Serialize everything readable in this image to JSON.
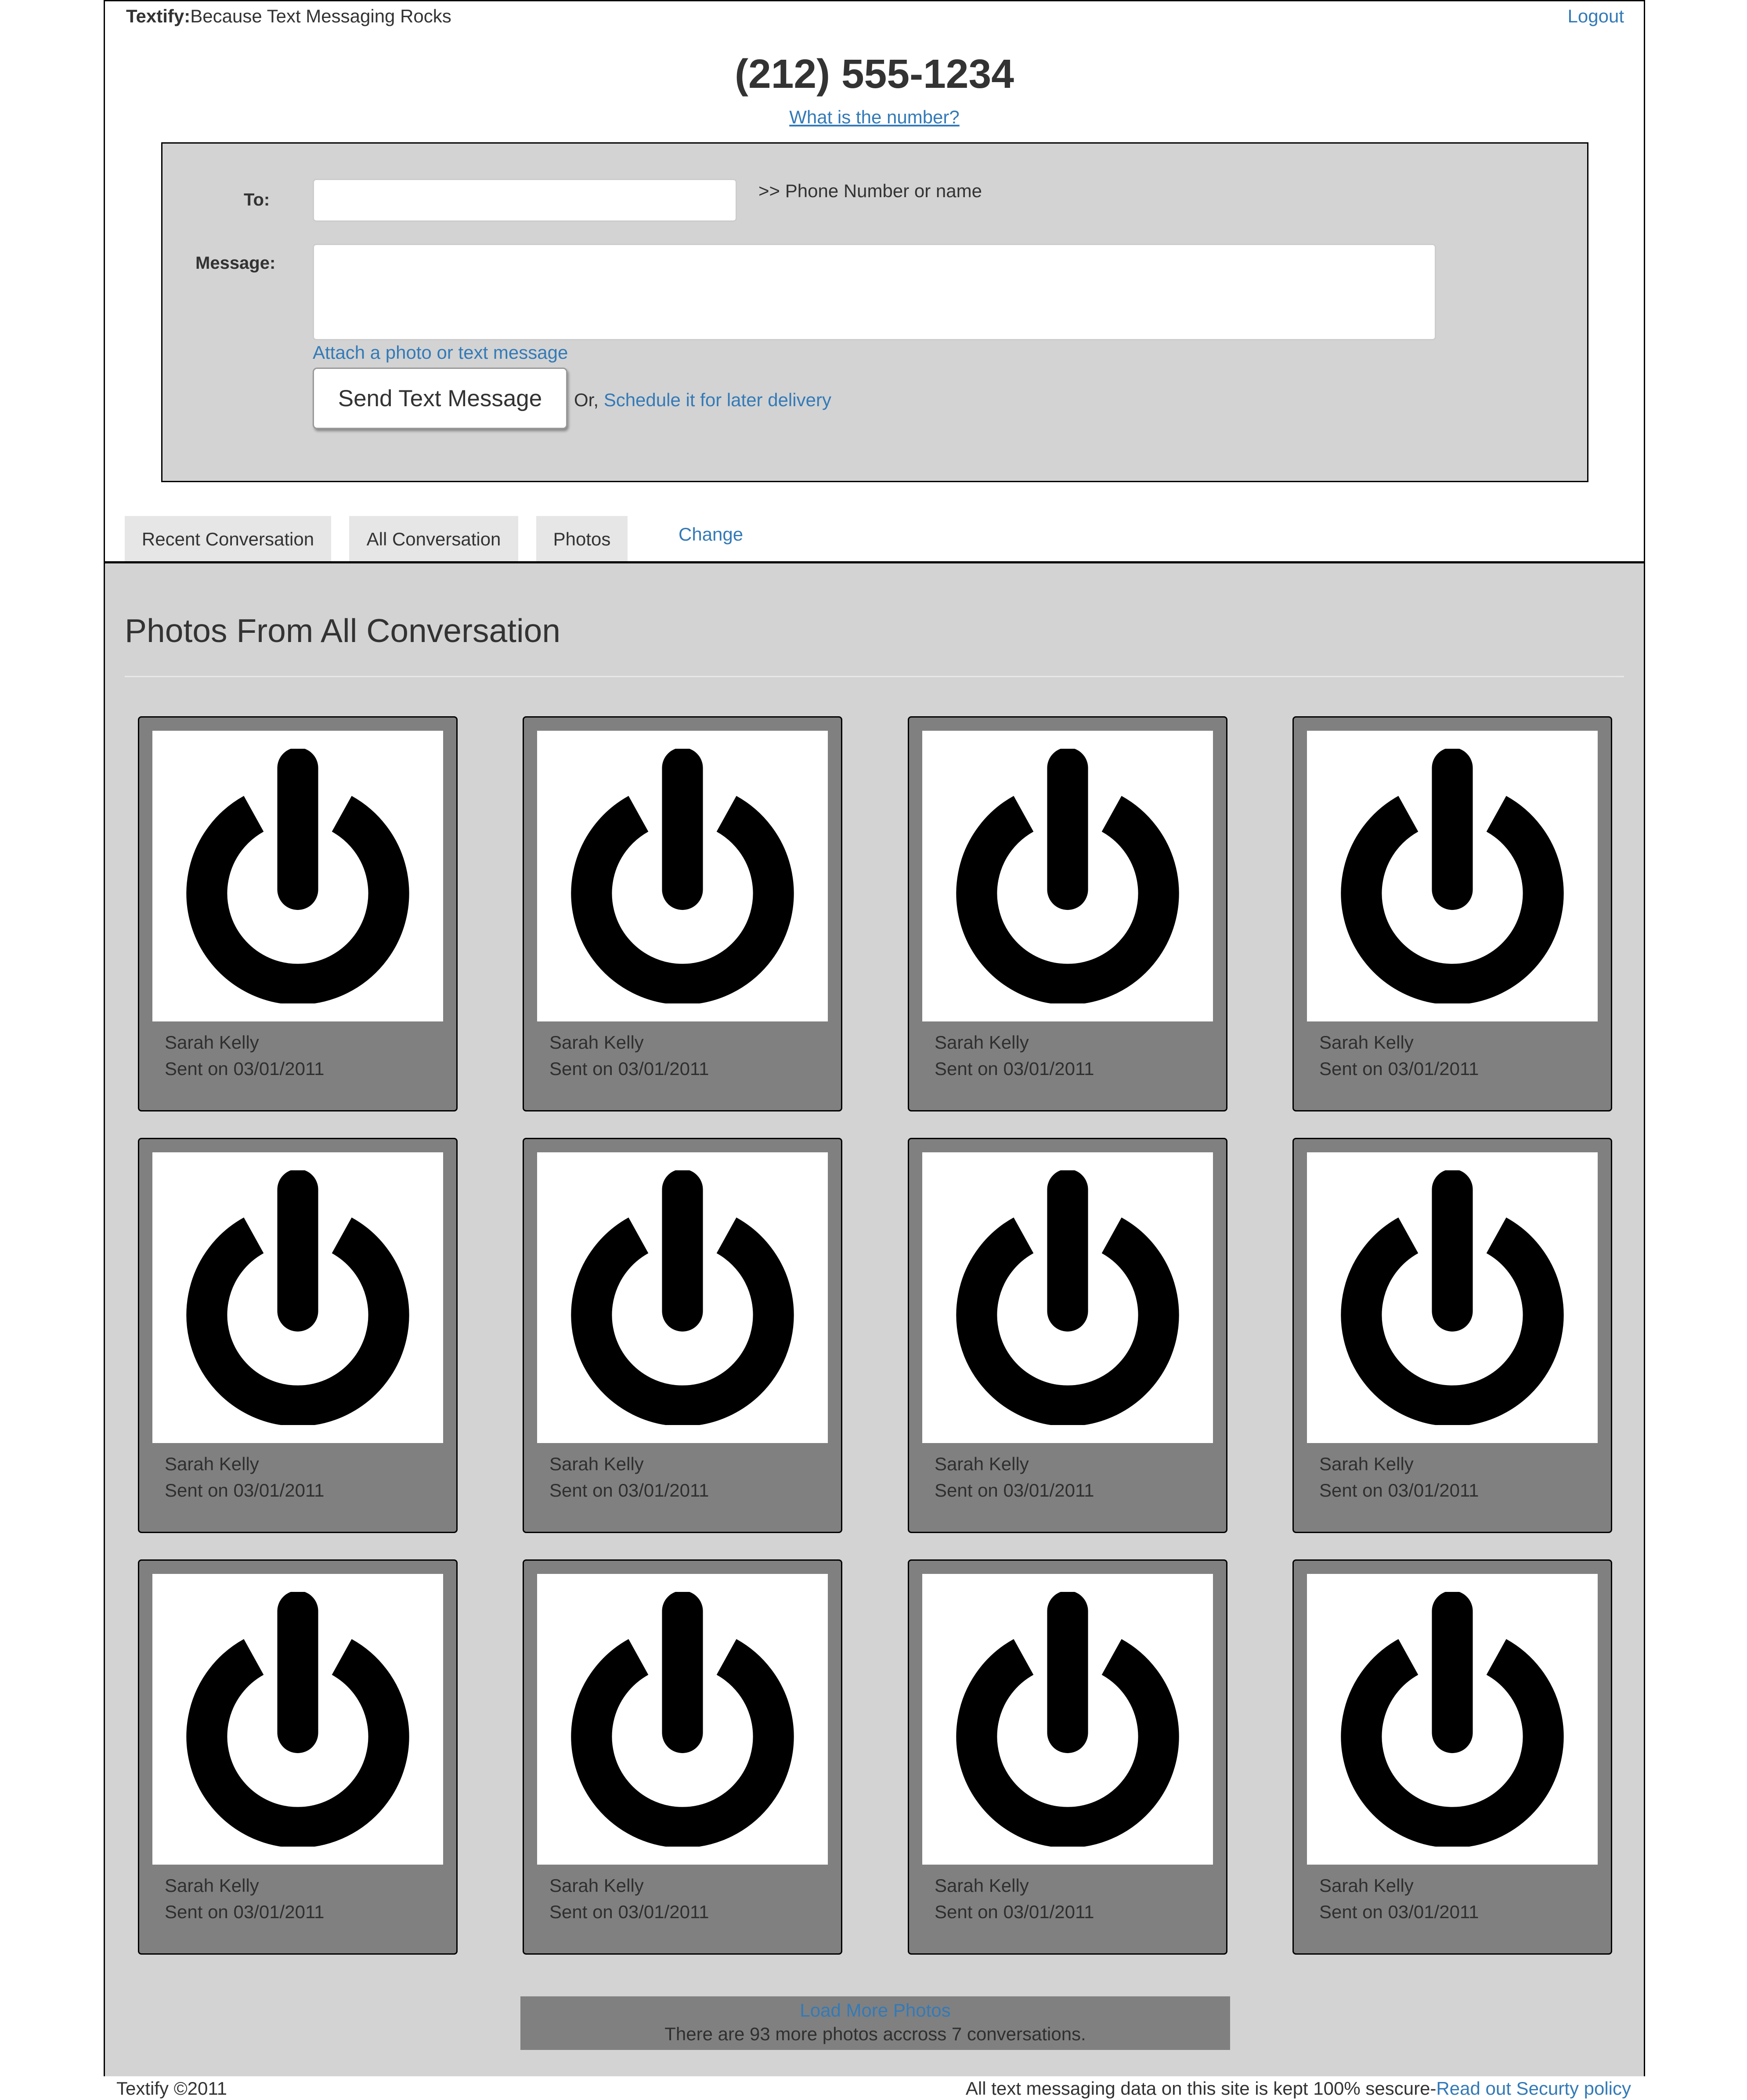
{
  "header": {
    "brand_name": "Textify:",
    "tagline": "Because Text Messaging Rocks",
    "logout_label": "Logout",
    "phone_number": "(212) 555-1234",
    "what_number_link": "What is the number?"
  },
  "compose": {
    "to_label": "To:",
    "to_value": "",
    "to_hint": ">> Phone Number or name",
    "message_label": "Message:",
    "message_value": "",
    "attach_link": "Attach a photo or text message",
    "send_button": "Send Text Message",
    "or_text": "Or,",
    "schedule_link": "Schedule it for later delivery"
  },
  "tabs": [
    {
      "label": "Recent Conversation"
    },
    {
      "label": "All Conversation"
    },
    {
      "label": "Photos"
    }
  ],
  "change_link": "Change",
  "gallery": {
    "title": "Photos From All Conversation",
    "photos": [
      {
        "sender": "Sarah Kelly",
        "sent": "Sent on 03/01/2011",
        "icon": "power-icon"
      },
      {
        "sender": "Sarah Kelly",
        "sent": "Sent on 03/01/2011",
        "icon": "power-icon"
      },
      {
        "sender": "Sarah Kelly",
        "sent": "Sent on 03/01/2011",
        "icon": "power-icon"
      },
      {
        "sender": "Sarah Kelly",
        "sent": "Sent on 03/01/2011",
        "icon": "power-icon"
      },
      {
        "sender": "Sarah Kelly",
        "sent": "Sent on 03/01/2011",
        "icon": "power-icon"
      },
      {
        "sender": "Sarah Kelly",
        "sent": "Sent on 03/01/2011",
        "icon": "power-icon"
      },
      {
        "sender": "Sarah Kelly",
        "sent": "Sent on 03/01/2011",
        "icon": "power-icon"
      },
      {
        "sender": "Sarah Kelly",
        "sent": "Sent on 03/01/2011",
        "icon": "power-icon"
      },
      {
        "sender": "Sarah Kelly",
        "sent": "Sent on 03/01/2011",
        "icon": "power-icon"
      },
      {
        "sender": "Sarah Kelly",
        "sent": "Sent on 03/01/2011",
        "icon": "power-icon"
      },
      {
        "sender": "Sarah Kelly",
        "sent": "Sent on 03/01/2011",
        "icon": "power-icon"
      },
      {
        "sender": "Sarah Kelly",
        "sent": "Sent on 03/01/2011",
        "icon": "power-icon"
      }
    ],
    "load_more_link": "Load More Photos",
    "load_more_note": "There are 93 more photos accross 7 conversations."
  },
  "footer": {
    "copyright": "Textify ©2011",
    "security_text": "All text messaging data on this site is kept 100% sescure-",
    "policy_link": "Read out Securty policy"
  },
  "colors": {
    "link": "#337ab7",
    "panel": "#d3d3d3",
    "card": "#808080",
    "tab": "#e6e6e6"
  }
}
